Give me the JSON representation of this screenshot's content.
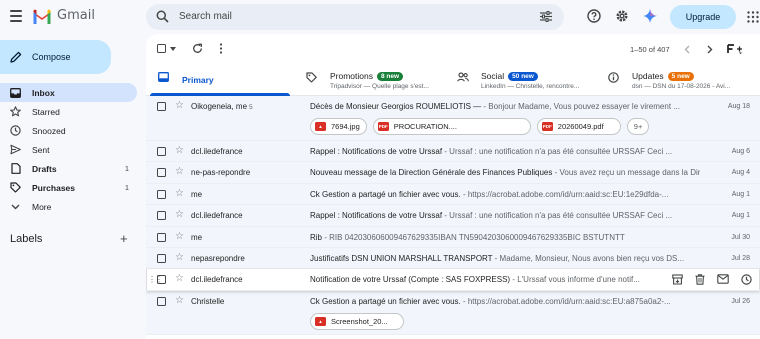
{
  "header": {
    "brand": "Gmail",
    "search_placeholder": "Search mail",
    "upgrade_label": "Upgrade",
    "colors": {
      "gmail_red": "#ea4335",
      "accent_blue": "#0b57d0",
      "upgrade_bg": "#c2e7ff"
    }
  },
  "compose": {
    "label": "Compose"
  },
  "sidebar": {
    "items": [
      {
        "label": "Inbox",
        "count": "",
        "icon": "inbox-icon"
      },
      {
        "label": "Starred",
        "count": "",
        "icon": "star-icon"
      },
      {
        "label": "Snoozed",
        "count": "",
        "icon": "clock-icon"
      },
      {
        "label": "Sent",
        "count": "",
        "icon": "send-icon"
      },
      {
        "label": "Drafts",
        "count": "1",
        "icon": "draft-icon"
      },
      {
        "label": "Purchases",
        "count": "1",
        "icon": "tag-icon"
      },
      {
        "label": "More",
        "count": "",
        "icon": "chevron-down-icon"
      }
    ],
    "labels_heading": "Labels"
  },
  "toolbar": {
    "pager": "1–50 of 407"
  },
  "tabs": [
    {
      "name": "Primary",
      "badge": "",
      "sub": "",
      "icon": "inbox-icon"
    },
    {
      "name": "Promotions",
      "badge": "8 new",
      "badge_color": "#188038",
      "sub": "Tripadvisor — Quelle plage s'est...",
      "icon": "tag-icon"
    },
    {
      "name": "Social",
      "badge": "50 new",
      "badge_color": "#0b57d0",
      "sub": "LinkedIn — Christelle, rencontre...",
      "icon": "people-icon"
    },
    {
      "name": "Updates",
      "badge": "5 new",
      "badge_color": "#e8710a",
      "sub": "dsn — DSN du 17-08-2026 - Avi...",
      "icon": "info-icon"
    }
  ],
  "emails": [
    {
      "sender": "Oikogeneia, me",
      "count": "5",
      "subject": "Décès de Monsieur Georgios ROUMELIOTIS —",
      "snippet": " - Bonjour Madame, Vous pouvez essayer le virement ...",
      "date": "Aug 18",
      "attachments": [
        {
          "name": "7694.jpg",
          "type": "IMG"
        },
        {
          "name": "PROCURATION....",
          "type": "PDF"
        },
        {
          "name": "20260049.pdf",
          "type": "PDF"
        }
      ],
      "more": "9+"
    },
    {
      "sender": "dcl.iledefrance",
      "count": "",
      "subject": "Rappel : Notifications de votre Urssaf",
      "snippet": " - Urssaf : une notification n'a pas été consultée URSSAF Ceci ...",
      "date": "Aug 6"
    },
    {
      "sender": "ne-pas-repondre",
      "count": "",
      "subject": "Nouveau message de la Direction Générale des Finances Publiques",
      "snippet": " - Vous avez reçu un message dans la Direct...",
      "date": "Aug 4"
    },
    {
      "sender": "me",
      "count": "",
      "subject": "Ck Gestion a partagé un fichier avec vous.",
      "snippet": " - https://acrobat.adobe.com/id/urn:aaid:sc:EU:1e29dfda-...",
      "date": "Aug 1"
    },
    {
      "sender": "dcl.iledefrance",
      "count": "",
      "subject": "Rappel : Notifications de votre Urssaf",
      "snippet": " - Urssaf : une notification n'a pas été consultée URSSAF Ceci ...",
      "date": "Aug 1"
    },
    {
      "sender": "me",
      "count": "",
      "subject": "Rib",
      "snippet": " - RIB 042030606009467629335IBAN TN5904203060009467629335BIC BSTUTNTT",
      "date": "Jul 30"
    },
    {
      "sender": "nepasrepondre",
      "count": "",
      "subject": "Justificatifs DSN UNION MARSHALL TRANSPORT",
      "snippet": " - Madame, Monsieur, Nous avons bien reçu vos DS...",
      "date": "Jul 28"
    },
    {
      "sender": "dcl.iledefrance",
      "count": "",
      "subject": "Notification de votre Urssaf (Compte : SAS FOXPRESS)",
      "snippet": " - L'Urssaf vous informe d'une notif...",
      "date": ""
    },
    {
      "sender": "Christelle",
      "count": "",
      "subject": "Ck Gestion a partagé un fichier avec vous.",
      "snippet": " - https://acrobat.adobe.com/id/urn:aaid:sc:EU:a875a0a2-...",
      "date": "Jul 26",
      "attachments": [
        {
          "name": "Screenshot_20...",
          "type": "PDF"
        }
      ],
      "more": ""
    }
  ]
}
